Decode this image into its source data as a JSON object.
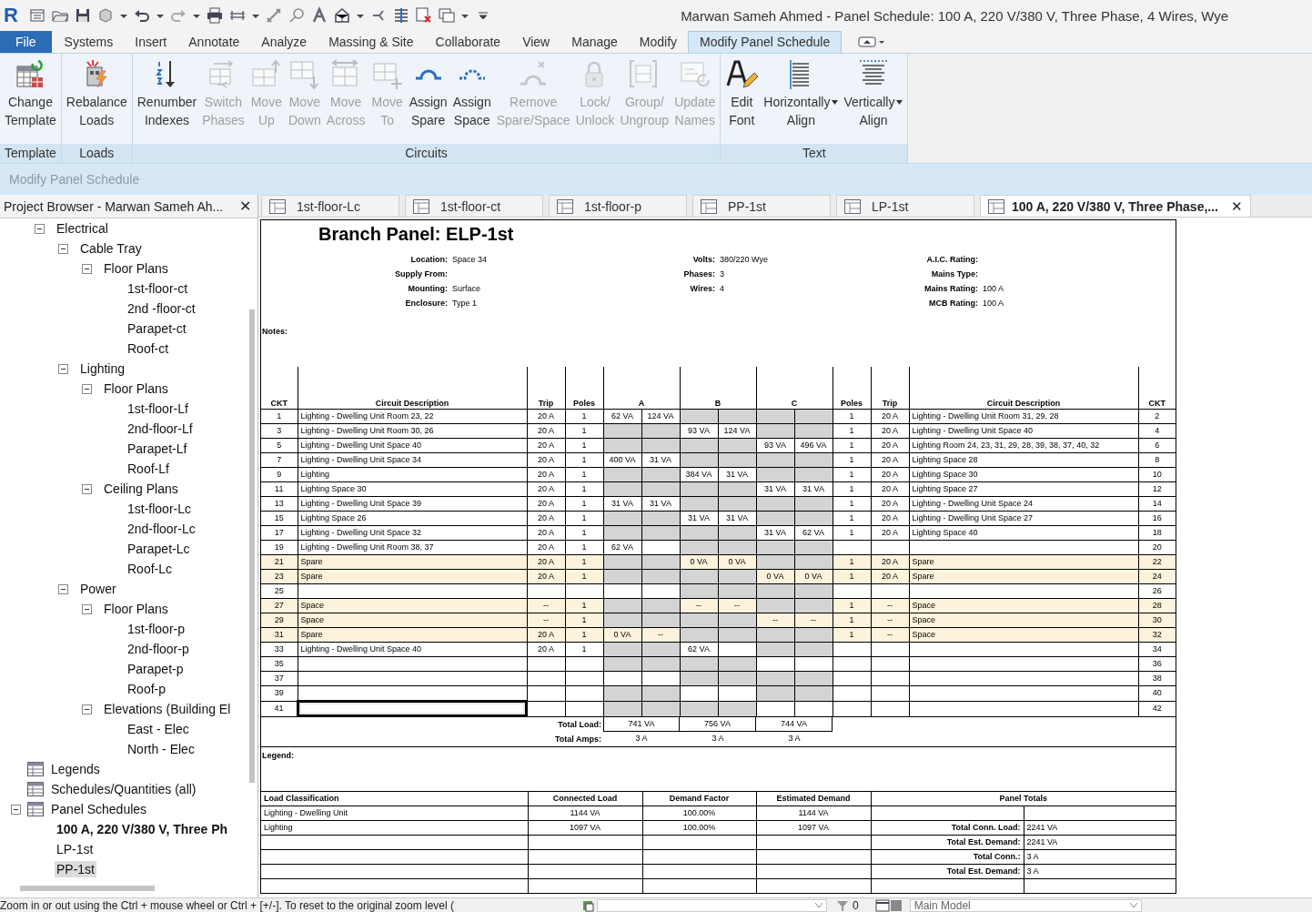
{
  "window": {
    "logo": "R",
    "title": "Marwan Sameh Ahmed - Panel Schedule: 100 A, 220 V/380 V, Three Phase, 4 Wires, Wye"
  },
  "menu": [
    {
      "label": "File",
      "kind": "app",
      "selected": false
    },
    {
      "label": "Systems",
      "kind": "tab",
      "selected": false
    },
    {
      "label": "Insert",
      "kind": "tab",
      "selected": false
    },
    {
      "label": "Annotate",
      "kind": "tab",
      "selected": false
    },
    {
      "label": "Analyze",
      "kind": "tab",
      "selected": false
    },
    {
      "label": "Massing & Site",
      "kind": "tab",
      "selected": false
    },
    {
      "label": "Collaborate",
      "kind": "tab",
      "selected": false
    },
    {
      "label": "View",
      "kind": "tab",
      "selected": false
    },
    {
      "label": "Manage",
      "kind": "tab",
      "selected": false
    },
    {
      "label": "Modify",
      "kind": "tab",
      "selected": false
    },
    {
      "label": "Modify Panel Schedule",
      "kind": "tab",
      "selected": true
    }
  ],
  "ribbon": {
    "groups": [
      {
        "label": "Template",
        "buttons": [
          {
            "label": [
              "Change",
              "Template"
            ],
            "disabled": false,
            "dropdown": false
          }
        ]
      },
      {
        "label": "Loads",
        "buttons": [
          {
            "label": [
              "Rebalance",
              "Loads"
            ],
            "disabled": false,
            "dropdown": false
          }
        ]
      },
      {
        "label": "Circuits",
        "buttons": [
          {
            "label": [
              "Renumber",
              "Indexes"
            ],
            "disabled": false,
            "dropdown": false
          },
          {
            "label": [
              "Switch",
              "Phases"
            ],
            "disabled": true,
            "dropdown": false
          },
          {
            "label": [
              "Move",
              "Up"
            ],
            "disabled": true,
            "dropdown": false
          },
          {
            "label": [
              "Move",
              "Down"
            ],
            "disabled": true,
            "dropdown": false
          },
          {
            "label": [
              "Move",
              "Across"
            ],
            "disabled": true,
            "dropdown": false
          },
          {
            "label": [
              "Move",
              "To"
            ],
            "disabled": true,
            "dropdown": false
          },
          {
            "label": [
              "Assign",
              "Spare"
            ],
            "disabled": false,
            "dropdown": false
          },
          {
            "label": [
              "Assign",
              "Space"
            ],
            "disabled": false,
            "dropdown": false
          },
          {
            "label": [
              "Remove",
              "Spare/Space"
            ],
            "disabled": true,
            "dropdown": false
          },
          {
            "label": [
              "Lock/",
              "Unlock"
            ],
            "disabled": true,
            "dropdown": false
          },
          {
            "label": [
              "Group/",
              "Ungroup"
            ],
            "disabled": true,
            "dropdown": false
          },
          {
            "label": [
              "Update",
              "Names"
            ],
            "disabled": true,
            "dropdown": false
          }
        ]
      },
      {
        "label": "Text",
        "buttons": [
          {
            "label": [
              "Edit",
              "Font"
            ],
            "disabled": false,
            "dropdown": false
          },
          {
            "label": [
              "Horizontally",
              "Align"
            ],
            "disabled": false,
            "dropdown": true
          },
          {
            "label": [
              "Vertically",
              "Align"
            ],
            "disabled": false,
            "dropdown": true
          }
        ]
      }
    ]
  },
  "options_bar": {
    "label": "Modify Panel Schedule"
  },
  "project_browser": {
    "title": "Project Browser - Marwan Sameh Ah...",
    "close": "✕",
    "items": [
      {
        "label": "Electrical",
        "kind": "group",
        "expanded": true,
        "children": [
          {
            "label": "Cable Tray",
            "expanded": true,
            "children": [
              {
                "label": "Floor Plans",
                "expanded": true,
                "children": [
                  {
                    "label": "1st-floor-ct"
                  },
                  {
                    "label": "2nd -floor-ct"
                  },
                  {
                    "label": "Parapet-ct"
                  },
                  {
                    "label": "Roof-ct"
                  }
                ]
              }
            ]
          },
          {
            "label": "Lighting",
            "expanded": true,
            "children": [
              {
                "label": "Floor Plans",
                "expanded": true,
                "children": [
                  {
                    "label": "1st-floor-Lf"
                  },
                  {
                    "label": "2nd-floor-Lf"
                  },
                  {
                    "label": "Parapet-Lf"
                  },
                  {
                    "label": "Roof-Lf"
                  }
                ]
              },
              {
                "label": "Ceiling Plans",
                "expanded": true,
                "children": [
                  {
                    "label": "1st-floor-Lc"
                  },
                  {
                    "label": "2nd-floor-Lc"
                  },
                  {
                    "label": "Parapet-Lc"
                  },
                  {
                    "label": "Roof-Lc"
                  }
                ]
              }
            ]
          },
          {
            "label": "Power",
            "expanded": true,
            "children": [
              {
                "label": "Floor Plans",
                "expanded": true,
                "children": [
                  {
                    "label": "1st-floor-p"
                  },
                  {
                    "label": "2nd-floor-p"
                  },
                  {
                    "label": "Parapet-p"
                  },
                  {
                    "label": "Roof-p"
                  }
                ]
              },
              {
                "label": "Elevations (Building El",
                "expanded": true,
                "children": [
                  {
                    "label": "East - Elec"
                  },
                  {
                    "label": "North - Elec"
                  }
                ]
              }
            ]
          }
        ]
      },
      {
        "label": "Legends",
        "kind": "category"
      },
      {
        "label": "Schedules/Quantities (all)",
        "kind": "category"
      },
      {
        "label": "Panel Schedules",
        "kind": "category",
        "expanded": true,
        "children": [
          {
            "label": "100 A, 220 V/380 V, Three Ph",
            "active": true,
            "selected": false
          },
          {
            "label": "LP-1st",
            "active": false,
            "selected": false
          },
          {
            "label": "PP-1st",
            "active": false,
            "selected": true
          }
        ]
      }
    ]
  },
  "view_tabs": [
    {
      "label": "1st-floor-Lc",
      "selected": false
    },
    {
      "label": "1st-floor-ct",
      "selected": false
    },
    {
      "label": "1st-floor-p",
      "selected": false
    },
    {
      "label": "PP-1st",
      "selected": false
    },
    {
      "label": "LP-1st",
      "selected": false
    },
    {
      "label": "100 A, 220 V/380 V, Three Phase,...",
      "selected": true,
      "close": "✕"
    }
  ],
  "schedule": {
    "title": "Branch Panel: ELP-1st",
    "info": [
      [
        {
          "label": "Location:",
          "value": "Space 34"
        },
        {
          "label": "Supply From:"
        },
        {
          "label": "Mounting:",
          "value": "Surface"
        },
        {
          "label": "Enclosure:",
          "value": "Type 1"
        }
      ],
      [
        {
          "label": "Volts:",
          "value": "380/220 Wye"
        },
        {
          "label": "Phases:",
          "value": "3"
        },
        {
          "label": "Wires:",
          "value": "4"
        }
      ],
      [
        {
          "label": "A.I.C. Rating:"
        },
        {
          "label": "Mains Type:"
        },
        {
          "label": "Mains Rating:",
          "value": "100 A"
        },
        {
          "label": "MCB Rating:",
          "value": "100 A"
        }
      ]
    ],
    "notes_label": "Notes:",
    "columns": [
      {
        "label": "CKT"
      },
      {
        "label": "Circuit Description"
      },
      {
        "label": "Trip"
      },
      {
        "label": "Poles"
      },
      {
        "label": "A",
        "kind": "phase"
      },
      {
        "label": "B",
        "kind": "phase"
      },
      {
        "label": "C",
        "kind": "phase"
      },
      {
        "label": "Poles"
      },
      {
        "label": "Trip"
      },
      {
        "label": "Circuit Description"
      },
      {
        "label": "CKT"
      }
    ],
    "rows": [
      {
        "phase_a": true,
        "phase_b": false,
        "phase_c": false,
        "selected": false,
        "left": {
          "ckt": "1",
          "description": "Lighting - Dwelling Unit Room 23, 22",
          "trip": "20 A",
          "poles": "1",
          "load": "62 VA",
          "highlight": false
        },
        "right": {
          "ckt": "2",
          "description": "Lighting - Dwelling Unit Room 31, 29, 28",
          "trip": "20 A",
          "poles": "1",
          "load": "124 VA",
          "highlight": false
        }
      },
      {
        "phase_a": false,
        "phase_b": true,
        "phase_c": false,
        "selected": false,
        "left": {
          "ckt": "3",
          "description": "Lighting - Dwelling Unit Room 30, 26",
          "trip": "20 A",
          "poles": "1",
          "load": "93 VA",
          "highlight": false
        },
        "right": {
          "ckt": "4",
          "description": "Lighting - Dwelling Unit Space 40",
          "trip": "20 A",
          "poles": "1",
          "load": "124 VA",
          "highlight": false
        }
      },
      {
        "phase_a": false,
        "phase_b": false,
        "phase_c": true,
        "selected": false,
        "left": {
          "ckt": "5",
          "description": "Lighting - Dwelling Unit Space 40",
          "trip": "20 A",
          "poles": "1",
          "load": "93 VA",
          "highlight": false
        },
        "right": {
          "ckt": "6",
          "description": "Lighting Room 24, 23, 31, 29, 28, 39, 38, 37, 40, 32",
          "trip": "20 A",
          "poles": "1",
          "load": "496 VA",
          "highlight": false
        }
      },
      {
        "phase_a": true,
        "phase_b": false,
        "phase_c": false,
        "selected": false,
        "left": {
          "ckt": "7",
          "description": "Lighting - Dwelling Unit Space 34",
          "trip": "20 A",
          "poles": "1",
          "load": "400 VA",
          "highlight": false
        },
        "right": {
          "ckt": "8",
          "description": "Lighting Space 28",
          "trip": "20 A",
          "poles": "1",
          "load": "31 VA",
          "highlight": false
        }
      },
      {
        "phase_a": false,
        "phase_b": true,
        "phase_c": false,
        "selected": false,
        "left": {
          "ckt": "9",
          "description": "Lighting",
          "trip": "20 A",
          "poles": "1",
          "load": "384 VA",
          "highlight": false
        },
        "right": {
          "ckt": "10",
          "description": "Lighting Space 30",
          "trip": "20 A",
          "poles": "1",
          "load": "31 VA",
          "highlight": false
        }
      },
      {
        "phase_a": false,
        "phase_b": false,
        "phase_c": true,
        "selected": false,
        "left": {
          "ckt": "11",
          "description": "Lighting Space 30",
          "trip": "20 A",
          "poles": "1",
          "load": "31 VA",
          "highlight": false
        },
        "right": {
          "ckt": "12",
          "description": "Lighting Space 27",
          "trip": "20 A",
          "poles": "1",
          "load": "31 VA",
          "highlight": false
        }
      },
      {
        "phase_a": true,
        "phase_b": false,
        "phase_c": false,
        "selected": false,
        "left": {
          "ckt": "13",
          "description": "Lighting - Dwelling Unit Space 39",
          "trip": "20 A",
          "poles": "1",
          "load": "31 VA",
          "highlight": false
        },
        "right": {
          "ckt": "14",
          "description": "Lighting - Dwelling Unit Space 24",
          "trip": "20 A",
          "poles": "1",
          "load": "31 VA",
          "highlight": false
        }
      },
      {
        "phase_a": false,
        "phase_b": true,
        "phase_c": false,
        "selected": false,
        "left": {
          "ckt": "15",
          "description": "Lighting Space 26",
          "trip": "20 A",
          "poles": "1",
          "load": "31 VA",
          "highlight": false
        },
        "right": {
          "ckt": "16",
          "description": "Lighting - Dwelling Unit Space 27",
          "trip": "20 A",
          "poles": "1",
          "load": "31 VA",
          "highlight": false
        }
      },
      {
        "phase_a": false,
        "phase_b": false,
        "phase_c": true,
        "selected": false,
        "left": {
          "ckt": "17",
          "description": "Lighting - Dwelling Unit Space 32",
          "trip": "20 A",
          "poles": "1",
          "load": "31 VA",
          "highlight": false
        },
        "right": {
          "ckt": "18",
          "description": "Lighting Space 40",
          "trip": "20 A",
          "poles": "1",
          "load": "62 VA",
          "highlight": false
        }
      },
      {
        "phase_a": true,
        "phase_b": false,
        "phase_c": false,
        "selected": false,
        "left": {
          "ckt": "19",
          "description": "Lighting - Dwelling Unit Room 38, 37",
          "trip": "20 A",
          "poles": "1",
          "load": "62 VA",
          "highlight": false
        },
        "right": {
          "ckt": "20",
          "highlight": false
        }
      },
      {
        "phase_a": false,
        "phase_b": true,
        "phase_c": false,
        "selected": false,
        "left": {
          "ckt": "21",
          "description": "Spare",
          "trip": "20 A",
          "poles": "1",
          "load": "0 VA",
          "highlight": true
        },
        "right": {
          "ckt": "22",
          "description": "Spare",
          "trip": "20 A",
          "poles": "1",
          "load": "0 VA",
          "highlight": true
        }
      },
      {
        "phase_a": false,
        "phase_b": false,
        "phase_c": true,
        "selected": false,
        "left": {
          "ckt": "23",
          "description": "Spare",
          "trip": "20 A",
          "poles": "1",
          "load": "0 VA",
          "highlight": true
        },
        "right": {
          "ckt": "24",
          "description": "Spare",
          "trip": "20 A",
          "poles": "1",
          "load": "0 VA",
          "highlight": true
        }
      },
      {
        "phase_a": true,
        "phase_b": false,
        "phase_c": false,
        "selected": false,
        "left": {
          "ckt": "25",
          "highlight": false
        },
        "right": {
          "ckt": "26",
          "highlight": false
        }
      },
      {
        "phase_a": false,
        "phase_b": true,
        "phase_c": false,
        "selected": false,
        "left": {
          "ckt": "27",
          "description": "Space",
          "trip": "--",
          "poles": "1",
          "load": "--",
          "highlight": true
        },
        "right": {
          "ckt": "28",
          "description": "Space",
          "trip": "--",
          "poles": "1",
          "load": "--",
          "highlight": true
        }
      },
      {
        "phase_a": false,
        "phase_b": false,
        "phase_c": true,
        "selected": false,
        "left": {
          "ckt": "29",
          "description": "Space",
          "trip": "--",
          "poles": "1",
          "load": "--",
          "highlight": true
        },
        "right": {
          "ckt": "30",
          "description": "Space",
          "trip": "--",
          "poles": "1",
          "load": "--",
          "highlight": true
        }
      },
      {
        "phase_a": true,
        "phase_b": false,
        "phase_c": false,
        "selected": false,
        "left": {
          "ckt": "31",
          "description": "Spare",
          "trip": "20 A",
          "poles": "1",
          "load": "0 VA",
          "highlight": true
        },
        "right": {
          "ckt": "32",
          "description": "Space",
          "trip": "--",
          "poles": "1",
          "load": "--",
          "highlight": true
        }
      },
      {
        "phase_a": false,
        "phase_b": true,
        "phase_c": false,
        "selected": false,
        "left": {
          "ckt": "33",
          "description": "Lighting - Dwelling Unit Space 40",
          "trip": "20 A",
          "poles": "1",
          "load": "62 VA",
          "highlight": false
        },
        "right": {
          "ckt": "34",
          "highlight": false
        }
      },
      {
        "phase_a": false,
        "phase_b": false,
        "phase_c": true,
        "selected": false,
        "left": {
          "ckt": "35",
          "highlight": false
        },
        "right": {
          "ckt": "36",
          "highlight": false
        }
      },
      {
        "phase_a": true,
        "phase_b": false,
        "phase_c": false,
        "selected": false,
        "left": {
          "ckt": "37",
          "highlight": false
        },
        "right": {
          "ckt": "38",
          "highlight": false
        }
      },
      {
        "phase_a": false,
        "phase_b": true,
        "phase_c": false,
        "selected": false,
        "left": {
          "ckt": "39",
          "highlight": false
        },
        "right": {
          "ckt": "40",
          "highlight": false
        }
      },
      {
        "phase_a": false,
        "phase_b": false,
        "phase_c": true,
        "selected": true,
        "left": {
          "ckt": "41",
          "highlight": false
        },
        "right": {
          "ckt": "42",
          "highlight": false
        }
      }
    ],
    "totals": [
      {
        "label": "Total Load:",
        "values": [
          "741 VA",
          "756 VA",
          "744 VA"
        ]
      },
      {
        "label": "Total Amps:",
        "values": [
          "3 A",
          "3 A",
          "3 A"
        ]
      }
    ],
    "legend_label": "Legend:",
    "summary": {
      "columns": [
        "Load Classification",
        "Connected Load",
        "Demand Factor",
        "Estimated Demand",
        "Panel Totals"
      ],
      "rows": [
        {
          "cells": [
            "Lighting - Dwelling Unit",
            "1144 VA",
            "100.00%",
            "1144 VA"
          ]
        },
        {
          "cells": [
            "Lighting",
            "1097 VA",
            "100.00%",
            "1097 VA"
          ],
          "total_label": "Total Conn. Load:",
          "total_value": "2241 VA"
        },
        {
          "total_label": "Total Est. Demand:",
          "total_value": "2241 VA"
        },
        {
          "total_label": "Total Conn.:",
          "total_value": "3 A"
        },
        {
          "total_label": "Total Est. Demand:",
          "total_value": "3 A"
        }
      ]
    }
  },
  "status_bar": {
    "text": "Zoom in or out using the Ctrl + mouse wheel or Ctrl + [+/-]. To reset to the original zoom level (",
    "count": "0",
    "model": "Main Model"
  }
}
